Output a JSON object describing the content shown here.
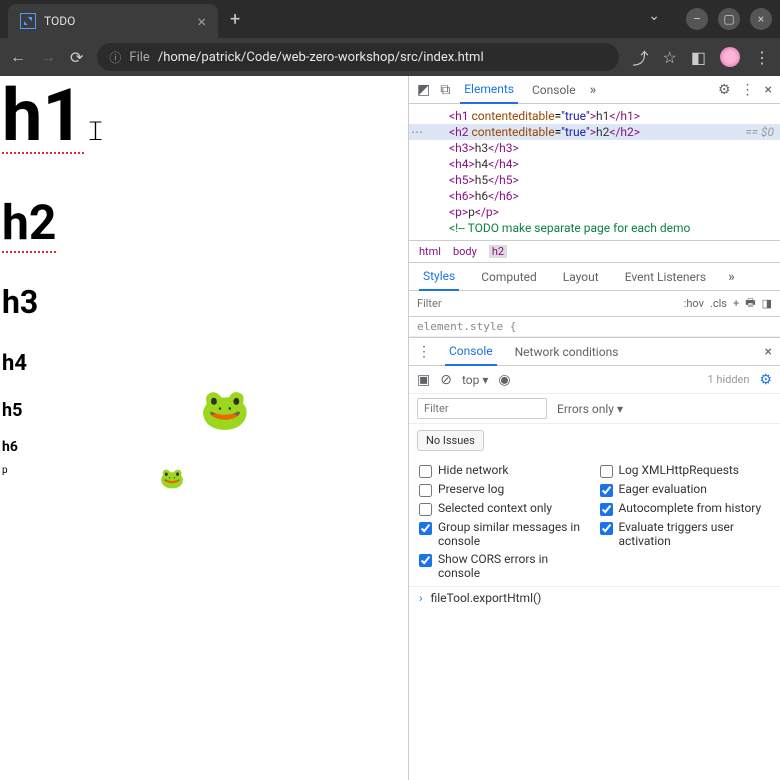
{
  "window": {
    "tab_title": "TODO",
    "url_prefix": "File",
    "url_path": "/home/patrick/Code/web-zero-workshop/src/index.html"
  },
  "content": {
    "h1": "h1",
    "h2": "h2",
    "h3": "h3",
    "h4": "h4",
    "h5": "h5",
    "h6": "h6",
    "p": "p"
  },
  "devtools": {
    "tabs": {
      "elements": "Elements",
      "console": "Console"
    },
    "dom": {
      "h1_open": "<h1 ",
      "h1_attr": "contenteditable",
      "h1_val": "\"true\"",
      "h1_txt": "h1",
      "h1_close": "</h1>",
      "h2_open": "<h2 ",
      "h2_attr": "contenteditable",
      "h2_val": "\"true\"",
      "h2_txt": "h2",
      "h2_close": "</h2>",
      "eq": "== $0",
      "h3": "<h3>",
      "h3t": "h3",
      "h3c": "</h3>",
      "h4": "<h4>",
      "h4t": "h4",
      "h4c": "</h4>",
      "h5": "<h5>",
      "h5t": "h5",
      "h5c": "</h5>",
      "h6": "<h6>",
      "h6t": "h6",
      "h6c": "</h6>",
      "p": "<p>",
      "pt": "p",
      "pc": "</p>",
      "comment": "<!-- TODO make separate page for each demo"
    },
    "breadcrumb": {
      "html": "html",
      "body": "body",
      "h2": "h2"
    },
    "styles_tabs": {
      "styles": "Styles",
      "computed": "Computed",
      "layout": "Layout",
      "listeners": "Event Listeners"
    },
    "filter_placeholder": "Filter",
    "hov": ":hov",
    "cls": ".cls",
    "element_style": "element.style {",
    "drawer_tabs": {
      "console": "Console",
      "network": "Network conditions"
    },
    "top": "top",
    "hidden": "1 hidden",
    "errors_only": "Errors only",
    "no_issues": "No Issues",
    "settings": {
      "hide_network": "Hide network",
      "log_xhr": "Log XMLHttpRequests",
      "preserve_log": "Preserve log",
      "eager": "Eager evaluation",
      "selected_ctx": "Selected context only",
      "autocomplete": "Autocomplete from history",
      "group": "Group similar messages in console",
      "triggers": "Evaluate triggers user activation",
      "cors": "Show CORS errors in console"
    },
    "console_input": "fileTool.exportHtml()"
  }
}
